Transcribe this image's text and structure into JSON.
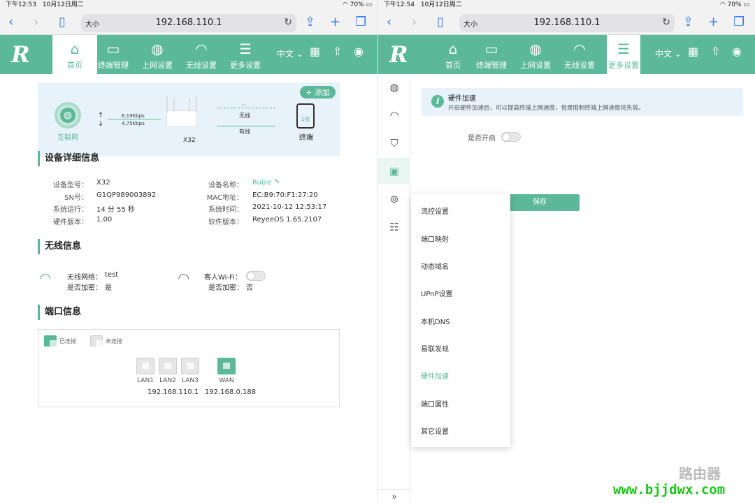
{
  "colors": {
    "accent": "#5bb898",
    "topo_bg": "#e7f2fa"
  },
  "left": {
    "status": {
      "time": "下午12:53",
      "date": "10月12日周二",
      "battery": "70%"
    },
    "browser": {
      "size_label": "大小",
      "url": "192.168.110.1"
    },
    "nav": {
      "logo": "R",
      "items": [
        {
          "icon": "home-icon",
          "glyph": "⌂",
          "label": "首页"
        },
        {
          "icon": "devices-icon",
          "glyph": "▭",
          "label": "终端管理"
        },
        {
          "icon": "globe-icon",
          "glyph": "◍",
          "label": "上网设置"
        },
        {
          "icon": "wifi-icon",
          "glyph": "◠",
          "label": "无线设置"
        },
        {
          "icon": "sliders-icon",
          "glyph": "☰",
          "label": "更多设置"
        }
      ],
      "lang": "中文"
    },
    "topo": {
      "add": "+ 添加",
      "internet": "互联网",
      "up_speed": "6.19Kbps",
      "down_speed": "4.75Kbps",
      "router": "X32",
      "wireless": "无线",
      "wired": "有线",
      "device_count": "1台",
      "terminal": "终端"
    },
    "device": {
      "title": "设备详细信息",
      "model_label": "设备型号：",
      "model": "X32",
      "sn_label": "SN号：",
      "sn": "G1QP989003892",
      "uptime_label": "系统运行：",
      "uptime": "14 分 55 秒",
      "hw_label": "硬件版本：",
      "hw": "1.00",
      "name_label": "设备名称：",
      "name": "Ruijie",
      "mac_label": "MAC地址：",
      "mac": "EC:B9:70:F1:27:20",
      "time_label": "系统时间：",
      "time": "2021-10-12 12:53:17",
      "sw_label": "软件版本：",
      "sw": "ReyeeOS 1.65.2107"
    },
    "wireless": {
      "title": "无线信息",
      "net_label": "无线网络：",
      "net": "test",
      "enc_label": "是否加密：",
      "enc": "是",
      "guest_label": "客人Wi-Fi：",
      "guest_enc_label": "是否加密：",
      "guest_enc": "否"
    },
    "ports": {
      "title": "端口信息",
      "connected": "已连接",
      "disconnected": "未连接",
      "lan1": "LAN1",
      "lan2": "LAN2",
      "lan3": "LAN3",
      "wan": "WAN",
      "lan_ip": "192.168.110.1",
      "wan_ip": "192.168.0.188"
    }
  },
  "right": {
    "status": {
      "time": "下午12:54",
      "date": "10月12日周二",
      "battery": "70%"
    },
    "browser": {
      "size_label": "大小",
      "url": "192.168.110.1"
    },
    "notice": {
      "title": "硬件加速",
      "text": "开启硬件加速后，可以提高终端上网速度，但是限制终端上网速度将失效。"
    },
    "enable_label": "是否开启",
    "save": "保存",
    "menu": [
      "流控设置",
      "端口映射",
      "动态域名",
      "UPnP设置",
      "本机DNS",
      "易联发现",
      "硬件加速",
      "端口属性",
      "其它设置"
    ],
    "expand": "»"
  },
  "watermark": {
    "text": "路由器",
    "site": "www.bjjdwx.com"
  }
}
